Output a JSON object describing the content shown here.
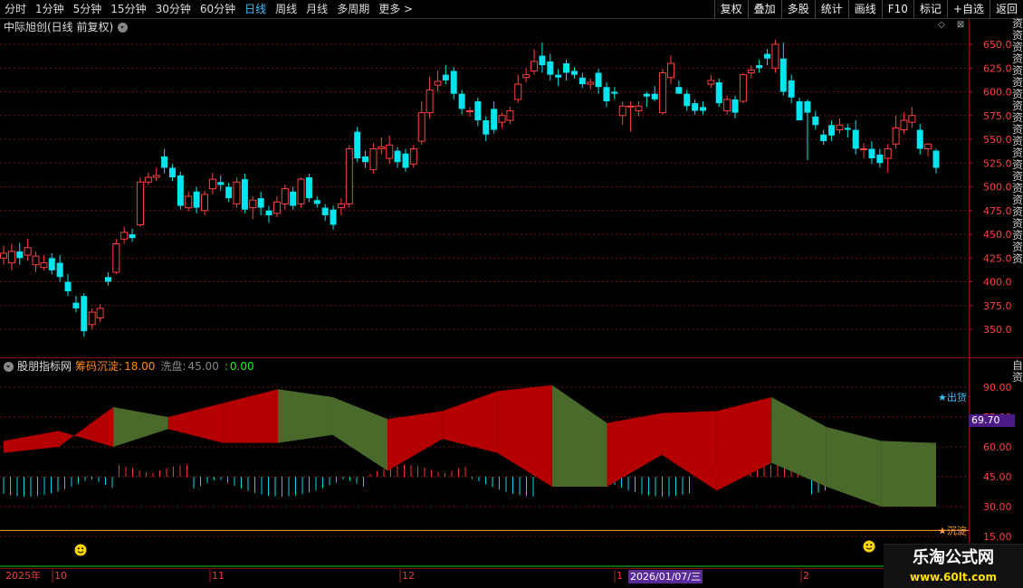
{
  "toolbar": {
    "periods": [
      "分时",
      "1分钟",
      "5分钟",
      "15分钟",
      "30分钟",
      "60分钟",
      "日线",
      "周线",
      "月线",
      "多周期",
      "更多 >"
    ],
    "active_index": 6,
    "buttons": [
      "复权",
      "叠加",
      "多股",
      "统计",
      "画线",
      "F10",
      "标记",
      "+自选",
      "返回"
    ]
  },
  "main_chart": {
    "title": "中际旭创(日线 前复权)",
    "y_ticks": [
      "650.0",
      "625.0",
      "600.0",
      "575.0",
      "550.0",
      "525.0",
      "500.0",
      "475.0",
      "450.0",
      "425.0",
      "400.0",
      "375.0",
      "350.0"
    ],
    "side_text": "资资资资资资资资资资资资资资资资资资资资资"
  },
  "indicator": {
    "name": "股朋指标网",
    "param1_label": "筹码沉淀:",
    "param1_value": "18.00",
    "param2_label": "洗盘:",
    "param2_value": "45.00",
    "param3_label": ":",
    "param3_value": "0.00",
    "y_ticks": [
      "90.00",
      "75.00",
      "60.00",
      "45.00",
      "30.00",
      "15.00"
    ],
    "label_top": "★出货",
    "label_bottom": "★沉淀",
    "cursor_value": "69.70",
    "side_text": "自资"
  },
  "date_axis": {
    "labels": [
      "2025年",
      "10",
      "11",
      "12",
      "1",
      "2"
    ],
    "highlight": "2026/01/07/三"
  },
  "watermark": {
    "line1": "乐淘公式网",
    "line2": "www.60lt.com"
  },
  "colors": {
    "up": "#ff4040",
    "down": "#00e5ee",
    "red_band": "#b40000",
    "green_band": "#4a6a2c",
    "grid": "#7a1010"
  },
  "chart_data": {
    "type": "candlestick",
    "y_range": [
      325,
      660
    ],
    "candles": [
      [
        425,
        430,
        438,
        418
      ],
      [
        420,
        432,
        440,
        412
      ],
      [
        432,
        425,
        441,
        418
      ],
      [
        428,
        436,
        445,
        422
      ],
      [
        418,
        427,
        432,
        410
      ],
      [
        415,
        420,
        428,
        412
      ],
      [
        425,
        412,
        430,
        408
      ],
      [
        420,
        405,
        428,
        400
      ],
      [
        400,
        390,
        408,
        385
      ],
      [
        378,
        372,
        385,
        368
      ],
      [
        385,
        348,
        388,
        342
      ],
      [
        355,
        368,
        372,
        350
      ],
      [
        362,
        372,
        376,
        358
      ],
      [
        405,
        400,
        410,
        396
      ],
      [
        410,
        440,
        445,
        408
      ],
      [
        445,
        452,
        458,
        440
      ],
      [
        450,
        446,
        456,
        442
      ],
      [
        460,
        505,
        510,
        458
      ],
      [
        505,
        510,
        515,
        502
      ],
      [
        510,
        512,
        520,
        506
      ],
      [
        532,
        520,
        540,
        514
      ],
      [
        520,
        510,
        524,
        506
      ],
      [
        512,
        480,
        516,
        476
      ],
      [
        478,
        490,
        495,
        474
      ],
      [
        495,
        478,
        500,
        472
      ],
      [
        475,
        492,
        496,
        470
      ],
      [
        498,
        508,
        515,
        492
      ],
      [
        505,
        502,
        512,
        496
      ],
      [
        500,
        488,
        504,
        484
      ],
      [
        482,
        505,
        510,
        478
      ],
      [
        508,
        476,
        514,
        472
      ],
      [
        478,
        486,
        490,
        466
      ],
      [
        488,
        478,
        495,
        470
      ],
      [
        475,
        470,
        480,
        462
      ],
      [
        472,
        484,
        490,
        468
      ],
      [
        482,
        498,
        502,
        476
      ],
      [
        495,
        480,
        500,
        476
      ],
      [
        482,
        508,
        510,
        478
      ],
      [
        510,
        488,
        514,
        484
      ],
      [
        486,
        482,
        490,
        478
      ],
      [
        478,
        470,
        482,
        464
      ],
      [
        476,
        460,
        480,
        455
      ],
      [
        478,
        482,
        488,
        470
      ],
      [
        482,
        540,
        544,
        478
      ],
      [
        558,
        530,
        563,
        526
      ],
      [
        532,
        526,
        538,
        520
      ],
      [
        518,
        540,
        546,
        514
      ],
      [
        540,
        542,
        552,
        534
      ],
      [
        530,
        544,
        554,
        524
      ],
      [
        538,
        526,
        542,
        520
      ],
      [
        535,
        520,
        540,
        516
      ],
      [
        524,
        540,
        544,
        520
      ],
      [
        548,
        578,
        590,
        544
      ],
      [
        578,
        602,
        616,
        572
      ],
      [
        607,
        611,
        622,
        600
      ],
      [
        618,
        612,
        628,
        608
      ],
      [
        622,
        598,
        626,
        592
      ],
      [
        598,
        582,
        602,
        576
      ],
      [
        580,
        580,
        584,
        574
      ],
      [
        590,
        570,
        594,
        564
      ],
      [
        570,
        555,
        574,
        548
      ],
      [
        582,
        560,
        590,
        556
      ],
      [
        568,
        575,
        578,
        562
      ],
      [
        570,
        580,
        584,
        566
      ],
      [
        592,
        608,
        618,
        588
      ],
      [
        615,
        618,
        625,
        610
      ],
      [
        622,
        632,
        645,
        618
      ],
      [
        638,
        628,
        652,
        620
      ],
      [
        632,
        618,
        640,
        612
      ],
      [
        618,
        615,
        624,
        606
      ],
      [
        630,
        620,
        634,
        612
      ],
      [
        622,
        618,
        626,
        614
      ],
      [
        615,
        608,
        620,
        604
      ],
      [
        608,
        610,
        614,
        602
      ],
      [
        620,
        605,
        624,
        598
      ],
      [
        605,
        590,
        610,
        584
      ],
      [
        600,
        598,
        605,
        592
      ],
      [
        575,
        585,
        590,
        565
      ],
      [
        585,
        585,
        590,
        558
      ],
      [
        580,
        585,
        590,
        574
      ],
      [
        598,
        595,
        600,
        584
      ],
      [
        598,
        592,
        606,
        590
      ],
      [
        578,
        620,
        624,
        576
      ],
      [
        615,
        630,
        638,
        608
      ],
      [
        605,
        598,
        612,
        600
      ],
      [
        598,
        585,
        602,
        580
      ],
      [
        588,
        580,
        592,
        576
      ],
      [
        584,
        580,
        590,
        576
      ],
      [
        608,
        612,
        618,
        604
      ],
      [
        610,
        588,
        614,
        584
      ],
      [
        580,
        592,
        596,
        576
      ],
      [
        592,
        578,
        596,
        572
      ],
      [
        590,
        618,
        620,
        588
      ],
      [
        620,
        623,
        628,
        614
      ],
      [
        628,
        625,
        634,
        620
      ],
      [
        640,
        635,
        645,
        628
      ],
      [
        625,
        650,
        655,
        620
      ],
      [
        635,
        600,
        652,
        596
      ],
      [
        612,
        594,
        618,
        588
      ],
      [
        590,
        570,
        594,
        570
      ],
      [
        590,
        578,
        592,
        528
      ],
      [
        574,
        565,
        580,
        560
      ],
      [
        555,
        548,
        560,
        544
      ],
      [
        565,
        554,
        570,
        548
      ],
      [
        560,
        565,
        572,
        556
      ],
      [
        562,
        560,
        566,
        552
      ],
      [
        560,
        540,
        570,
        534
      ],
      [
        540,
        540,
        546,
        530
      ],
      [
        540,
        530,
        548,
        524
      ],
      [
        534,
        525,
        540,
        520
      ],
      [
        530,
        540,
        545,
        515
      ],
      [
        545,
        562,
        575,
        540
      ],
      [
        560,
        570,
        578,
        556
      ],
      [
        568,
        575,
        584,
        562
      ],
      [
        560,
        540,
        566,
        534
      ],
      [
        540,
        545,
        546,
        532
      ],
      [
        538,
        520,
        540,
        514
      ]
    ],
    "indicator_series": {
      "upper": [
        57,
        60,
        80,
        75,
        82,
        89,
        85,
        74,
        78,
        88,
        91,
        72,
        77,
        78,
        85,
        70,
        63,
        62
      ],
      "lower": [
        63,
        68,
        60,
        69,
        62,
        62,
        66,
        48,
        64,
        57,
        40,
        40,
        56,
        38,
        52,
        40,
        30,
        30
      ]
    }
  }
}
